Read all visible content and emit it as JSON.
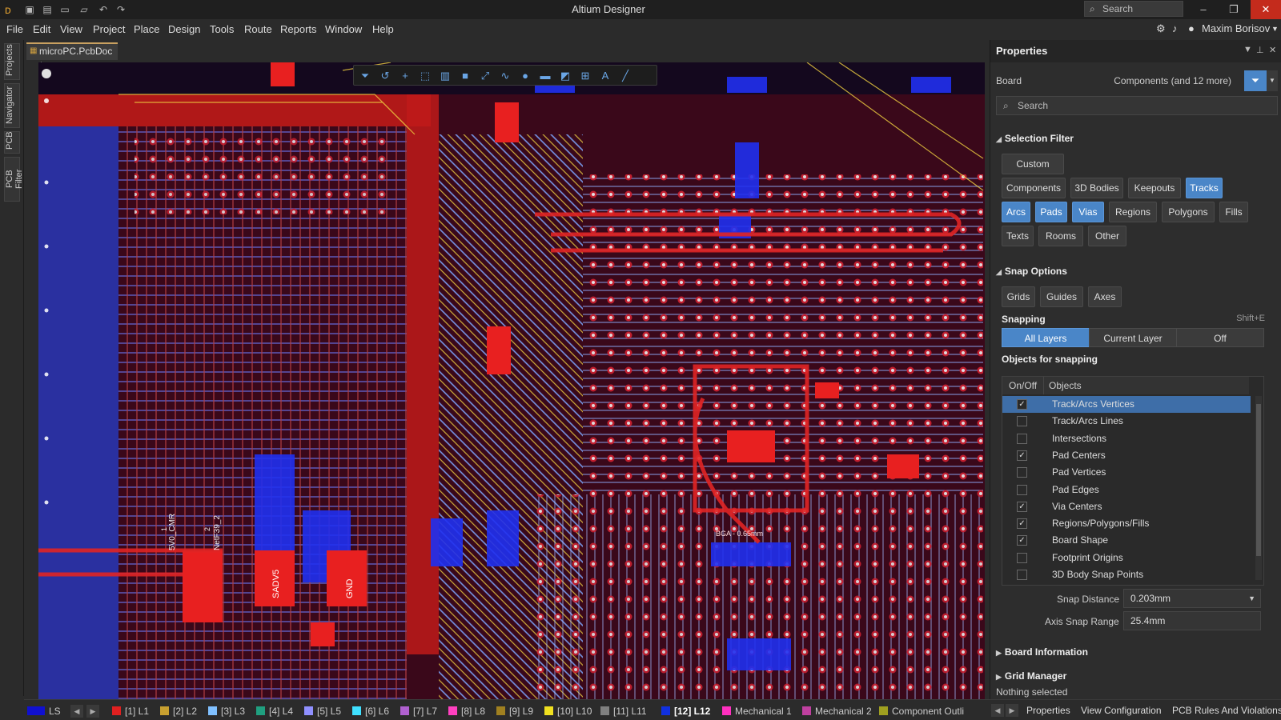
{
  "window": {
    "title": "Altium Designer",
    "search_placeholder": "Search",
    "minimize": "–",
    "restore": "❐",
    "close": "✕"
  },
  "menu": {
    "items": [
      "File",
      "Edit",
      "View",
      "Project",
      "Place",
      "Design",
      "Tools",
      "Route",
      "Reports",
      "Window",
      "Help"
    ],
    "user": "Maxim Borisov"
  },
  "left_strip": {
    "tabs": [
      "Projects",
      "Navigator",
      "PCB",
      "PCB Filter"
    ]
  },
  "document": {
    "tab_label": "microPC.PcbDoc *"
  },
  "canvas": {
    "labels": [
      "BGA - 0.65mm",
      "5V0_CMR",
      "NetF39_2",
      "1",
      "2",
      "SADV5",
      "GND"
    ]
  },
  "layers": [
    {
      "label": "LS",
      "color": "#1010d0"
    },
    {
      "label": "[1] L1",
      "color": "#e02020"
    },
    {
      "label": "[2] L2",
      "color": "#c8a030"
    },
    {
      "label": "[3] L3",
      "color": "#80c0ff"
    },
    {
      "label": "[4] L4",
      "color": "#20a080"
    },
    {
      "label": "[5] L5",
      "color": "#9090ff"
    },
    {
      "label": "[6] L6",
      "color": "#40e0ff"
    },
    {
      "label": "[7] L7",
      "color": "#b060d0"
    },
    {
      "label": "[8] L8",
      "color": "#ff40c0"
    },
    {
      "label": "[9] L9",
      "color": "#a08020"
    },
    {
      "label": "[10] L10",
      "color": "#f0e020"
    },
    {
      "label": "[11] L11",
      "color": "#808080"
    },
    {
      "label": "[12] L12",
      "color": "#1030e0"
    },
    {
      "label": "Mechanical 1",
      "color": "#ff30c0"
    },
    {
      "label": "Mechanical 2",
      "color": "#c040a0"
    },
    {
      "label": "Component Outli",
      "color": "#a0a020"
    }
  ],
  "panel": {
    "title": "Properties",
    "board_label": "Board",
    "filter_summary": "Components (and 12 more)",
    "search_placeholder": "Search",
    "selection_filter": {
      "title": "Selection Filter",
      "custom": "Custom",
      "chips": [
        {
          "label": "Components",
          "on": false
        },
        {
          "label": "3D Bodies",
          "on": false
        },
        {
          "label": "Keepouts",
          "on": false
        },
        {
          "label": "Tracks",
          "on": true
        },
        {
          "label": "Arcs",
          "on": true
        },
        {
          "label": "Pads",
          "on": true
        },
        {
          "label": "Vias",
          "on": true
        },
        {
          "label": "Regions",
          "on": false
        },
        {
          "label": "Polygons",
          "on": false
        },
        {
          "label": "Fills",
          "on": false
        },
        {
          "label": "Texts",
          "on": false
        },
        {
          "label": "Rooms",
          "on": false
        },
        {
          "label": "Other",
          "on": false
        }
      ]
    },
    "snap_options": {
      "title": "Snap Options",
      "buttons": [
        "Grids",
        "Guides",
        "Axes"
      ],
      "snapping_label": "Snapping",
      "snapping_shortcut": "Shift+E",
      "modes": [
        {
          "label": "All Layers",
          "on": true
        },
        {
          "label": "Current Layer",
          "on": false
        },
        {
          "label": "Off",
          "on": false
        }
      ],
      "objects_title": "Objects for snapping",
      "col_onoff": "On/Off",
      "col_objects": "Objects",
      "objects": [
        {
          "name": "Track/Arcs Vertices",
          "checked": true,
          "selected": true
        },
        {
          "name": "Track/Arcs Lines",
          "checked": false,
          "selected": false
        },
        {
          "name": "Intersections",
          "checked": false,
          "selected": false
        },
        {
          "name": "Pad Centers",
          "checked": true,
          "selected": false
        },
        {
          "name": "Pad Vertices",
          "checked": false,
          "selected": false
        },
        {
          "name": "Pad Edges",
          "checked": false,
          "selected": false
        },
        {
          "name": "Via Centers",
          "checked": true,
          "selected": false
        },
        {
          "name": "Regions/Polygons/Fills",
          "checked": true,
          "selected": false
        },
        {
          "name": "Board Shape",
          "checked": true,
          "selected": false
        },
        {
          "name": "Footprint Origins",
          "checked": false,
          "selected": false
        },
        {
          "name": "3D Body Snap Points",
          "checked": false,
          "selected": false
        }
      ],
      "snap_distance_label": "Snap Distance",
      "snap_distance": "0.203mm",
      "axis_snap_label": "Axis Snap Range",
      "axis_snap": "25.4mm"
    },
    "board_information": "Board Information",
    "grid_manager": "Grid Manager",
    "status": "Nothing selected"
  },
  "bottom_tabs": [
    "Properties",
    "View Configuration",
    "PCB Rules And Violations"
  ]
}
